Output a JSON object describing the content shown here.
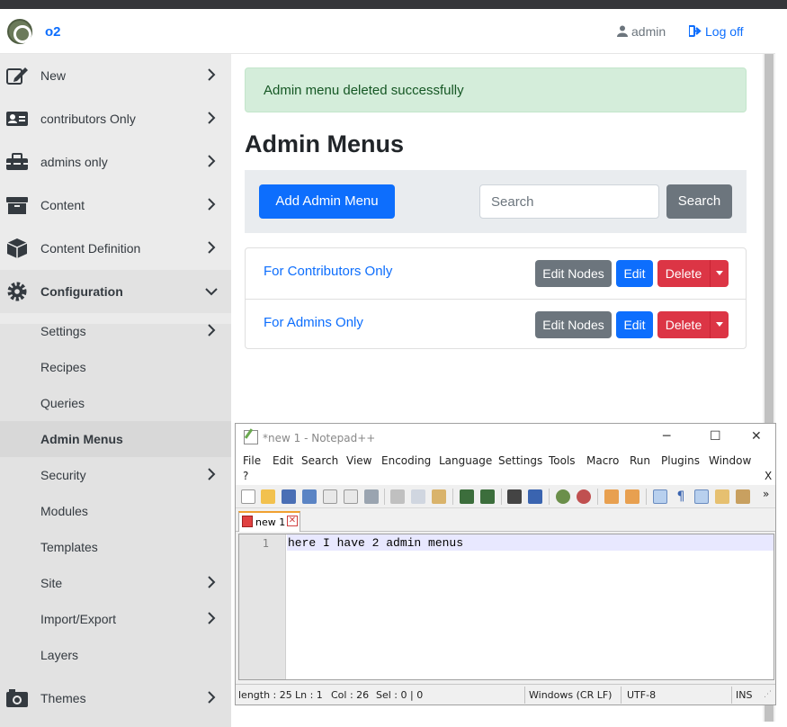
{
  "browser": {
    "brand": "o2",
    "user": "admin",
    "logoff": "Log off"
  },
  "sidebar": {
    "items": [
      {
        "label": "New",
        "icon": "edit-icon"
      },
      {
        "label": "contributors Only",
        "icon": "id-card-icon"
      },
      {
        "label": "admins only",
        "icon": "toolbox-icon"
      },
      {
        "label": "Content",
        "icon": "archive-box-icon"
      },
      {
        "label": "Content Definition",
        "icon": "cube-icon"
      },
      {
        "label": "Configuration",
        "icon": "cog-icon",
        "expanded": true
      }
    ],
    "sub_items": [
      {
        "label": "Settings",
        "has_children": true
      },
      {
        "label": "Recipes"
      },
      {
        "label": "Queries"
      },
      {
        "label": "Admin Menus",
        "active": true
      },
      {
        "label": "Security",
        "has_children": true
      },
      {
        "label": "Modules"
      },
      {
        "label": "Templates"
      },
      {
        "label": "Site",
        "has_children": true
      },
      {
        "label": "Import/Export",
        "has_children": true
      },
      {
        "label": "Layers"
      }
    ],
    "themes": {
      "label": "Themes",
      "icon": "camera-icon"
    }
  },
  "main": {
    "alert": "Admin menu deleted successfully",
    "title": "Admin Menus",
    "add_button": "Add Admin Menu",
    "search_placeholder": "Search",
    "search_button": "Search",
    "rows": [
      {
        "name": "For Contributors Only",
        "edit_nodes": "Edit Nodes",
        "edit": "Edit",
        "delete": "Delete"
      },
      {
        "name": "For Admins Only",
        "edit_nodes": "Edit Nodes",
        "edit": "Edit",
        "delete": "Delete"
      }
    ]
  },
  "notepad": {
    "title": "*new 1 - Notepad++",
    "menu": [
      "File",
      "Edit",
      "Search",
      "View",
      "Encoding",
      "Language",
      "Settings",
      "Tools",
      "Macro",
      "Run",
      "Plugins",
      "Window",
      "?"
    ],
    "menu_close": "X",
    "tab": "new 1",
    "line_number": "1",
    "line_text": "here I have 2 admin menus",
    "status": {
      "length": "length : 25",
      "ln": "Ln : 1",
      "col": "Col : 26",
      "sel": "Sel : 0 | 0",
      "eol": "Windows (CR LF)",
      "encoding": "UTF-8",
      "mode": "INS"
    }
  }
}
